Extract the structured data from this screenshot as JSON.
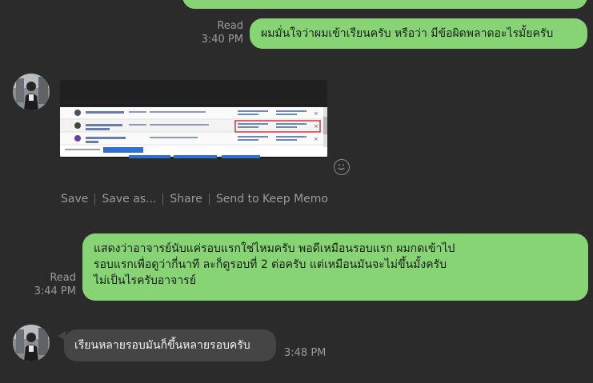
{
  "messages": {
    "top_partial": {
      "text": ""
    },
    "m1": {
      "read": "Read",
      "time": "3:40 PM",
      "text": "ผมมั่นใจว่าผมเข้าเรียนครับ หรือว่า มีข้อผิดพลาดอะไรมั้ยครับ"
    },
    "image_msg": {
      "actions": {
        "save": "Save",
        "save_as": "Save as...",
        "share": "Share",
        "keep_memo": "Send to Keep Memo"
      }
    },
    "m2": {
      "read": "Read",
      "time": "3:44 PM",
      "lines": [
        "แสดงว่าอาจารย์นับแค่รอบแรกใช่ไหมครับ พอดีเหมือนรอบแรก ผมกดเข้าไป",
        "รอบแรกเพื่อดูว่ากี่นาที ละก็ดูรอบที่ 2 ต่อครับ แต่เหมือนมันจะไม่ขึ้นมั้งครับ",
        "ไม่เป็นไรครับอาจารย์"
      ]
    },
    "m3": {
      "text": "เรียนหลายรอบมันก็ขึ้นหลายรอบครับ",
      "time": "3:48 PM"
    }
  },
  "colors": {
    "background": "#2b2b2b",
    "sent_bubble": "#86d474",
    "received_bubble": "#454545",
    "meta_text": "#9a9a9a"
  },
  "icons": {
    "emoji": "smiley-face-icon",
    "avatar": "user-avatar"
  }
}
